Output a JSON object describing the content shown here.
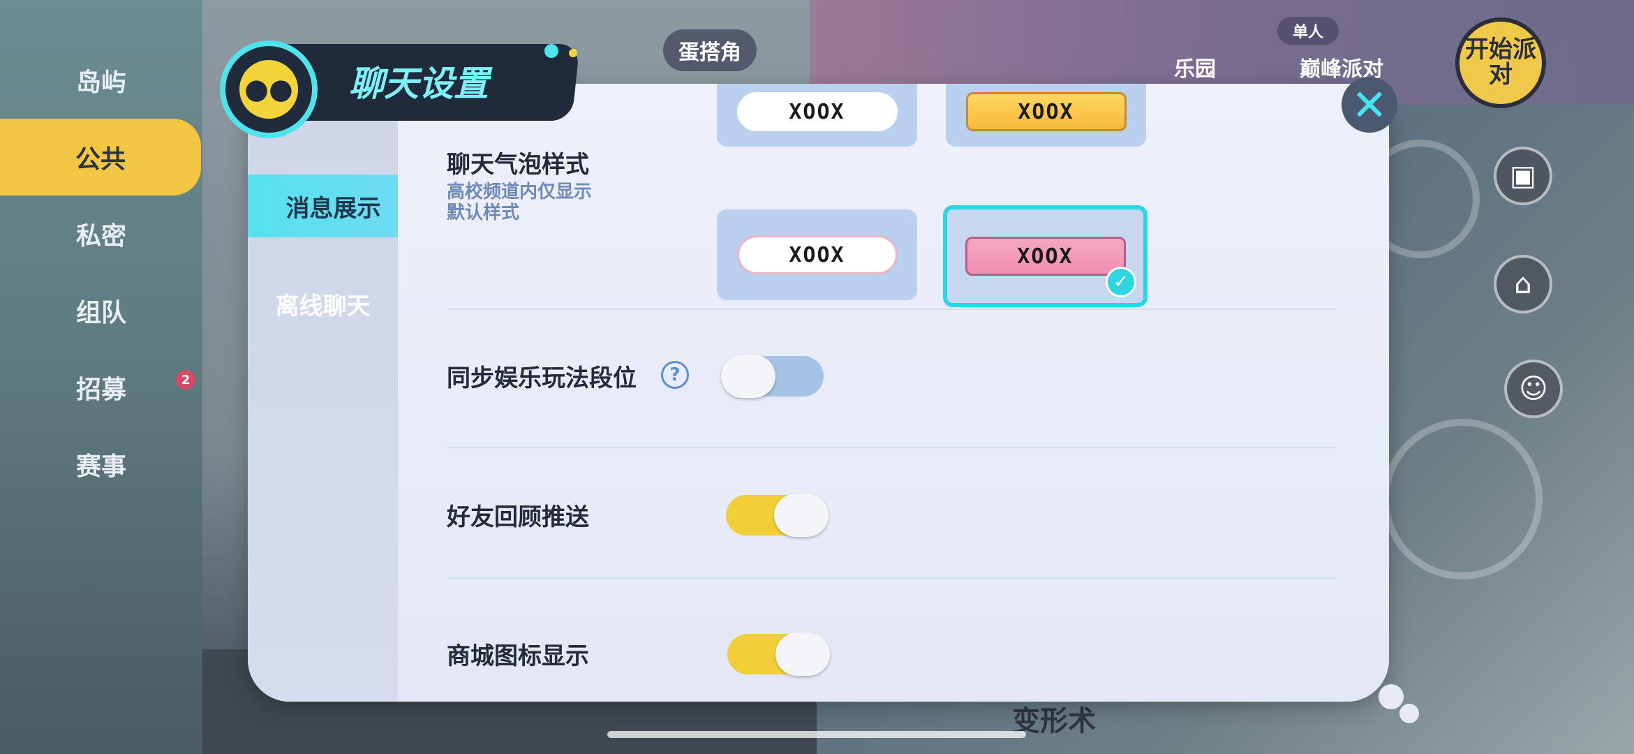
{
  "background": {
    "side_nav": [
      {
        "label": "岛屿",
        "active": false
      },
      {
        "label": "公共",
        "active": true
      },
      {
        "label": "私密",
        "active": false
      },
      {
        "label": "组队",
        "active": false
      },
      {
        "label": "招募",
        "active": false,
        "badge": "2"
      },
      {
        "label": "赛事",
        "active": false
      }
    ],
    "hud": {
      "egg_corner": "蛋搭角",
      "paradise": "乐园",
      "mode_single": "单人",
      "peak_party": "巅峰派对",
      "start_button": "开始派对",
      "transform": "变形术"
    }
  },
  "dialog": {
    "title": "聊天设置",
    "tabs": [
      {
        "label": "消息展示",
        "active": true
      },
      {
        "label": "离线聊天",
        "active": false
      }
    ],
    "bubble_style": {
      "title": "聊天气泡样式",
      "subtitle": "高校频道内仅显示默认样式",
      "options": [
        {
          "text": "XOOX",
          "style": "white",
          "selected": false
        },
        {
          "text": "XOOX",
          "style": "yellow",
          "selected": false
        },
        {
          "text": "XOOX",
          "style": "cute",
          "selected": false
        },
        {
          "text": "XOOX",
          "style": "pink",
          "selected": true
        }
      ]
    },
    "settings": [
      {
        "label": "同步娱乐玩法段位",
        "enabled": false,
        "has_help": true
      },
      {
        "label": "好友回顾推送",
        "enabled": true,
        "has_help": false
      },
      {
        "label": "商城图标显示",
        "enabled": true,
        "has_help": false
      }
    ],
    "help_glyph": "?",
    "check_glyph": "✓",
    "close_glyph": "✕"
  },
  "colors": {
    "accent_cyan": "#4de3ee",
    "toggle_on": "#f2cf38",
    "toggle_off": "#a6c2e4",
    "dialog_bg": "#e8ebf6",
    "header_bg": "#1f2a3b"
  }
}
